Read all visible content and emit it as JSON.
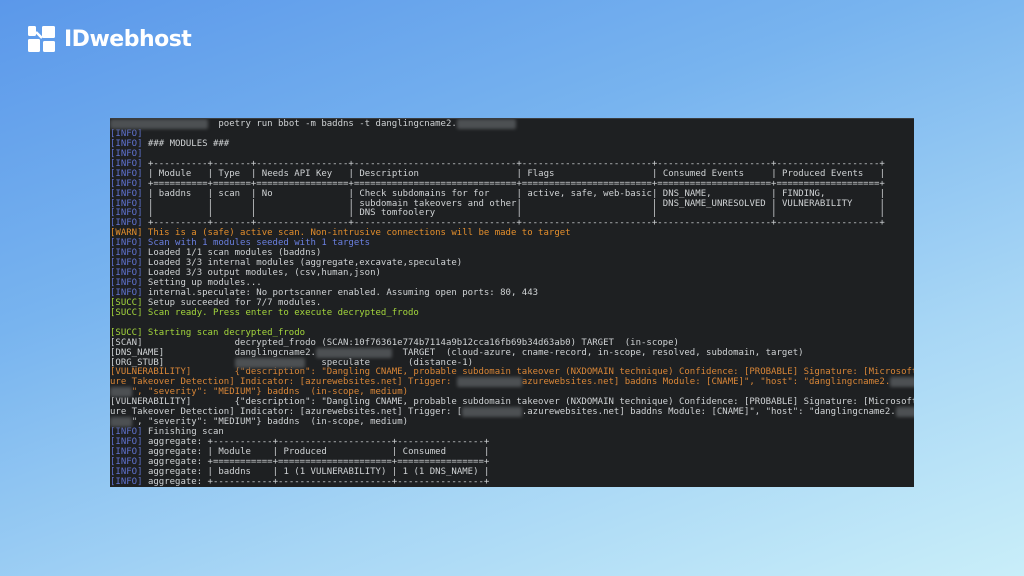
{
  "brand": {
    "name": "IDwebhost",
    "logo_icon": "idwebhost-logo-icon"
  },
  "colors": {
    "terminal_bg": "#1e2022",
    "info": "#5f72d0",
    "warn": "#e38e2c",
    "succ": "#a3d53c",
    "vuln": "#d98637"
  },
  "terminal": {
    "lines": [
      {
        "seg": [
          [
            "r",
            "                  "
          ],
          [
            "n",
            "  poetry run bbot -m baddns -t danglingcname2."
          ],
          [
            "r",
            "           "
          ]
        ]
      },
      {
        "seg": [
          [
            "i",
            "[INFO]"
          ]
        ]
      },
      {
        "seg": [
          [
            "i",
            "[INFO]"
          ],
          [
            "n",
            " ### MODULES ###"
          ]
        ]
      },
      {
        "seg": [
          [
            "i",
            "[INFO]"
          ]
        ]
      },
      {
        "table": "modules",
        "part": "border"
      },
      {
        "table": "modules",
        "part": "header"
      },
      {
        "table": "modules",
        "part": "double"
      },
      {
        "table": "modules",
        "part": "row",
        "row": 0,
        "sub": 0
      },
      {
        "table": "modules",
        "part": "row",
        "row": 0,
        "sub": 1
      },
      {
        "table": "modules",
        "part": "row",
        "row": 0,
        "sub": 2
      },
      {
        "table": "modules",
        "part": "border"
      },
      {
        "seg": [
          [
            "w",
            "[WARN] This is a (safe) active scan. Non-intrusive connections will be made to target"
          ]
        ]
      },
      {
        "seg": [
          [
            "i",
            "[INFO]"
          ],
          [
            "b",
            " Scan with 1 modules seeded with 1 targets"
          ]
        ]
      },
      {
        "seg": [
          [
            "i",
            "[INFO]"
          ],
          [
            "n",
            " Loaded 1/1 scan modules (baddns)"
          ]
        ]
      },
      {
        "seg": [
          [
            "i",
            "[INFO]"
          ],
          [
            "n",
            " Loaded 3/3 internal modules (aggregate,excavate,speculate)"
          ]
        ]
      },
      {
        "seg": [
          [
            "i",
            "[INFO]"
          ],
          [
            "n",
            " Loaded 3/3 output modules, (csv,human,json)"
          ]
        ]
      },
      {
        "seg": [
          [
            "i",
            "[INFO]"
          ],
          [
            "n",
            " Setting up modules..."
          ]
        ]
      },
      {
        "seg": [
          [
            "i",
            "[INFO]"
          ],
          [
            "n",
            " internal.speculate: No portscanner enabled. Assuming open ports: 80, 443"
          ]
        ]
      },
      {
        "seg": [
          [
            "s",
            "[SUCC]"
          ],
          [
            "n",
            " Setup succeeded for 7/7 modules."
          ]
        ]
      },
      {
        "seg": [
          [
            "s",
            "[SUCC] Scan ready. Press enter to execute decrypted_frodo"
          ]
        ]
      },
      {
        "seg": []
      },
      {
        "seg": [
          [
            "s",
            "[SUCC] Starting scan decrypted_frodo"
          ]
        ]
      },
      {
        "seg": [
          [
            "n",
            "[SCAN]                 decrypted_frodo (SCAN:10f76361e774b7114a9b12cca16fb69b34d63ab0) TARGET  (in-scope)"
          ]
        ]
      },
      {
        "seg": [
          [
            "n",
            "[DNS_NAME]             danglingcname2."
          ],
          [
            "r",
            "              "
          ],
          [
            "n",
            "  TARGET  (cloud-azure, cname-record, in-scope, resolved, subdomain, target)"
          ]
        ]
      },
      {
        "seg": [
          [
            "n",
            "[ORG_STUB]             "
          ],
          [
            "r",
            "             "
          ],
          [
            "n",
            "   speculate       (distance-1)"
          ]
        ]
      },
      {
        "seg": [
          [
            "v",
            "[VULNERABILITY]        {\"description\": \"Dangling CNAME, probable subdomain takeover (NXDOMAIN technique) Confidence: [PROBABLE] Signature: [Microsoft Az"
          ]
        ]
      },
      {
        "seg": [
          [
            "v",
            "ure Takeover Detection] Indicator: [azurewebsites.net] Trigger: "
          ],
          [
            "r",
            "            "
          ],
          [
            "v",
            "azurewebsites.net] baddns Module: [CNAME]\", \"host\": \"danglingcname2."
          ],
          [
            "r",
            "             "
          ]
        ]
      },
      {
        "seg": [
          [
            "r",
            "    "
          ],
          [
            "v",
            "\", \"severity\": \"MEDIUM\"} baddns  (in-scope, medium)"
          ]
        ]
      },
      {
        "seg": [
          [
            "n",
            "[VULNERABILITY]        {\"description\": \"Dangling CNAME, probable subdomain takeover (NXDOMAIN technique) Confidence: [PROBABLE] Signature: [Microsoft Az"
          ]
        ]
      },
      {
        "seg": [
          [
            "n",
            "ure Takeover Detection] Indicator: [azurewebsites.net] Trigger: ["
          ],
          [
            "r",
            "           "
          ],
          [
            "n",
            ".azurewebsites.net] baddns Module: [CNAME]\", \"host\": \"danglingcname2."
          ],
          [
            "r",
            "             "
          ]
        ]
      },
      {
        "seg": [
          [
            "r",
            "    "
          ],
          [
            "n",
            "\", \"severity\": \"MEDIUM\"} baddns  (in-scope, medium)"
          ]
        ]
      },
      {
        "seg": [
          [
            "i",
            "[INFO]"
          ],
          [
            "n",
            " Finishing scan"
          ]
        ]
      },
      {
        "table": "aggregate",
        "part": "border"
      },
      {
        "table": "aggregate",
        "part": "header"
      },
      {
        "table": "aggregate",
        "part": "double"
      },
      {
        "table": "aggregate",
        "part": "row",
        "row": 0,
        "sub": 0
      },
      {
        "table": "aggregate",
        "part": "border"
      }
    ],
    "tables": {
      "modules": {
        "tag": "[INFO]",
        "prefix": "",
        "columns": [
          "Module",
          "Type",
          "Needs API Key",
          "Description",
          "Flags",
          "Consumed Events",
          "Produced Events"
        ],
        "rows": [
          [
            [
              "baddns"
            ],
            [
              "scan"
            ],
            [
              "No"
            ],
            [
              "Check subdomains for for",
              "subdomain takeovers and other",
              "DNS tomfoolery"
            ],
            [
              "active, safe, web-basic"
            ],
            [
              "DNS_NAME,",
              "DNS_NAME_UNRESOLVED"
            ],
            [
              "FINDING,",
              "VULNERABILITY"
            ]
          ]
        ]
      },
      "aggregate": {
        "tag": "[INFO]",
        "prefix": "aggregate:",
        "columns": [
          "Module",
          "Produced",
          "Consumed"
        ],
        "rows": [
          [
            [
              "baddns"
            ],
            [
              "1 (1 VULNERABILITY)"
            ],
            [
              "1 (1 DNS_NAME)"
            ]
          ]
        ]
      }
    }
  }
}
